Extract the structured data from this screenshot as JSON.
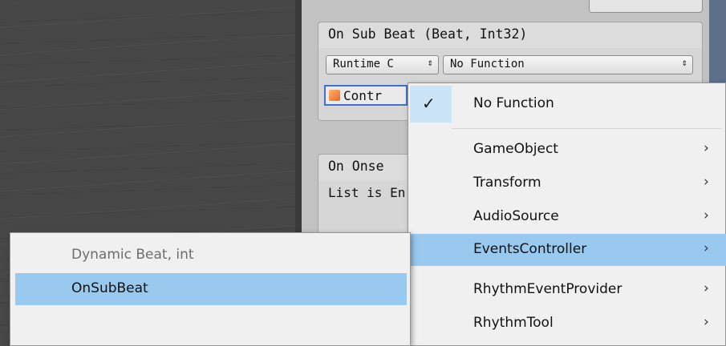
{
  "inspector": {
    "event1": {
      "header": "On Sub Beat (Beat, Int32)",
      "runtime_combo": "Runtime C",
      "function_combo": "No Function",
      "object_field": "Contr"
    },
    "event2": {
      "header": "On Onse",
      "body": "List is En"
    }
  },
  "menu": {
    "items": [
      {
        "label": "No Function",
        "checked": true
      },
      {
        "label": "GameObject",
        "submenu": true
      },
      {
        "label": "Transform",
        "submenu": true
      },
      {
        "label": "AudioSource",
        "submenu": true
      },
      {
        "label": "EventsController",
        "submenu": true,
        "highlighted": true
      },
      {
        "label": "RhythmEventProvider",
        "submenu": true
      },
      {
        "label": "RhythmTool",
        "submenu": true
      }
    ]
  },
  "submenu": {
    "header": "Dynamic Beat, int",
    "items": [
      {
        "label": "OnSubBeat",
        "highlighted": true
      }
    ]
  },
  "icons": {
    "combo_arrow": "⇕",
    "check": "✓",
    "chevron": "›"
  },
  "colors": {
    "highlight": "#99c9ef",
    "check_bg": "#cce4f7",
    "menu_bg": "#f0f0f0",
    "inspector_bg": "#c2c2c2",
    "scene_bg": "#474747"
  }
}
